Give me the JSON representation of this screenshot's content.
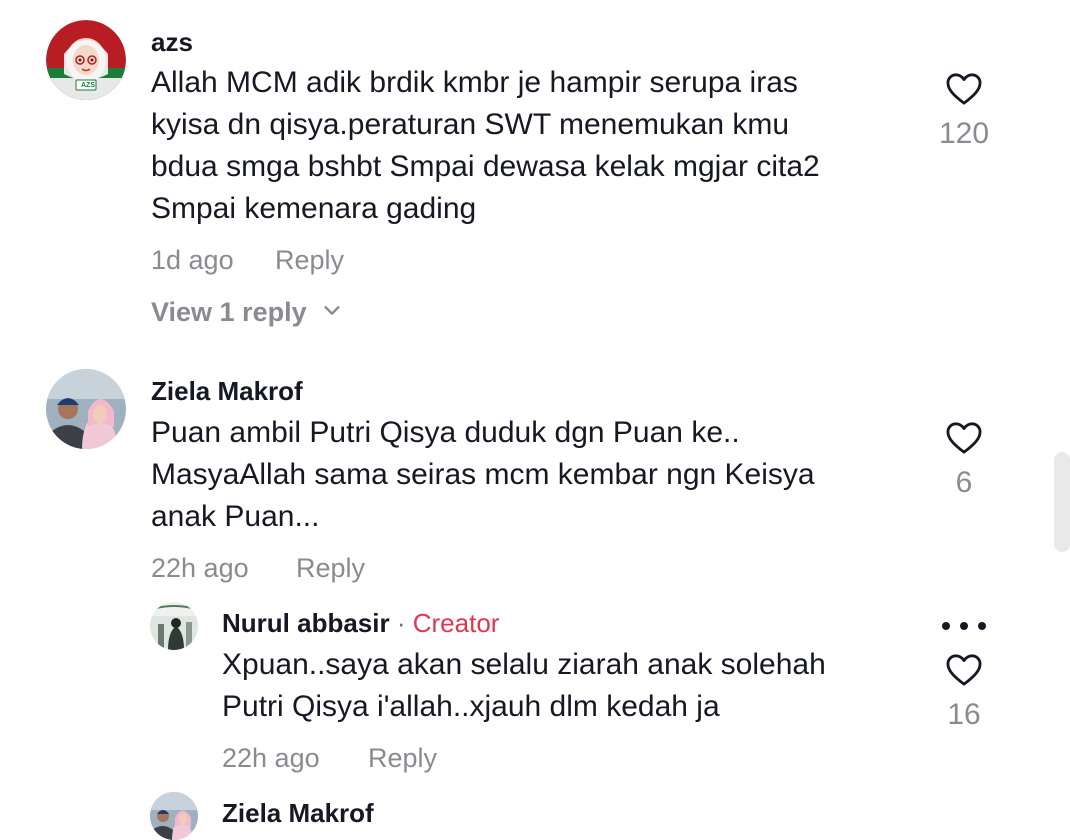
{
  "comments": [
    {
      "username": "azs",
      "avatar_badge": "AZS",
      "lines": [
        "Allah MCM adik brdik kmbr je hampir serupa iras",
        "kyisa dn qisya.peraturan SWT menemukan kmu",
        "bdua smga bshbt Smpai dewasa kelak mgjar cita2",
        "Smpai kemenara gading"
      ],
      "time": "1d ago",
      "reply_label": "Reply",
      "likes": "120",
      "view_replies": "View 1 reply"
    },
    {
      "username": "Ziela Makrof",
      "lines": [
        "Puan ambil Putri Qisya duduk dgn Puan ke..",
        "MasyaAllah sama seiras mcm kembar ngn Keisya",
        "anak Puan..."
      ],
      "time": "22h ago",
      "reply_label": "Reply",
      "likes": "6"
    }
  ],
  "replies": [
    {
      "username": "Nurul abbasir",
      "separator": "·",
      "creator_label": "Creator",
      "lines": [
        "Xpuan..saya akan selalu ziarah anak solehah",
        "Putri Qisya i'allah..xjauh dlm kedah ja"
      ],
      "time": "22h ago",
      "reply_label": "Reply",
      "likes": "16"
    },
    {
      "username": "Ziela Makrof"
    }
  ],
  "icons": {
    "like": "heart-outline-icon",
    "more": "more-horizontal-icon",
    "expand": "chevron-down-icon"
  },
  "colors": {
    "text": "#161823",
    "secondary": "#8a8b91",
    "creator": "#e2364f"
  }
}
